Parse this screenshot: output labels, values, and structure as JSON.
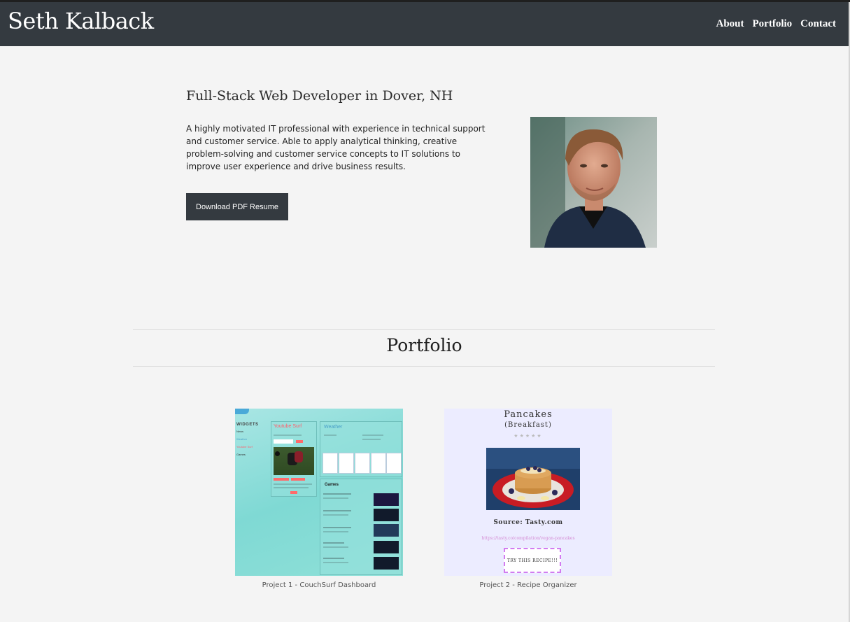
{
  "navbar": {
    "brand": "Seth Kalback",
    "links": [
      "About",
      "Portfolio",
      "Contact"
    ]
  },
  "hero": {
    "title": "Full-Stack Web Developer in Dover, NH",
    "description": "A highly motivated IT professional with experience in technical support and customer service. Able to apply analytical thinking, creative problem-solving and customer service concepts to IT solutions to improve user experience and drive business results.",
    "button_label": "Download PDF Resume"
  },
  "portfolio": {
    "title": "Portfolio",
    "projects": [
      {
        "caption": "Project 1 - CouchSurf Dashboard",
        "screenshot": {
          "sidebar_title": "WIDGETS",
          "sidebar_items": [
            "News",
            "Weather",
            "Youtube Surf",
            "Games"
          ],
          "youtube_title": "Youtube Surf",
          "weather_title": "Weather",
          "games_title": "Games"
        }
      },
      {
        "caption": "Project 2 - Recipe Organizer",
        "screenshot": {
          "recipe_title": "Pancakes",
          "recipe_category": "(Breakfast)",
          "stars": "★★★★★",
          "source": "Source: Tasty.com",
          "link": "https://tasty.co/compilation/vegan-pancakes",
          "cta": "TRY THIS RECIPE!!!"
        }
      }
    ]
  },
  "colors": {
    "navbar": "#343a40",
    "page_background": "#f4f4f4",
    "button": "#343a40"
  }
}
